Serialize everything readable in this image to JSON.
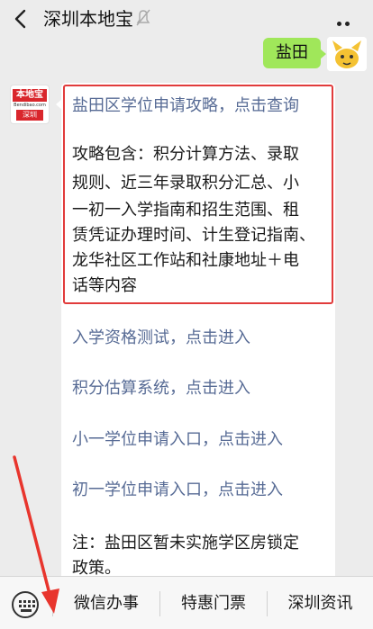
{
  "header": {
    "title": "深圳本地宝",
    "back_icon": "chevron-left-icon",
    "mute_icon": "mute-icon",
    "more_icon": "more-dots-icon"
  },
  "chat": {
    "sent_message": "盐田",
    "bot_logo": {
      "top": "本地宝",
      "mid": "Bendibao.com",
      "bottom": "深圳"
    },
    "lines": {
      "title_link": "盐田区学位申请攻略，点击查询",
      "para1_l1": "攻略包含：积分计算方法、录取",
      "para1_l2": "规则、近三年录取积分汇总、小",
      "para1_l3": "一初一入学指南和招生范围、租",
      "para1_l4": "赁凭证办理时间、计生登记指南、",
      "para1_l5": "龙华社区工作站和社康地址＋电",
      "para1_l6": "话等内容",
      "link1": "入学资格测试，点击进入",
      "link2": "积分估算系统，点击进入",
      "link3": "小一学位申请入口，点击进入",
      "link4": "初一学位申请入口，点击进入",
      "note_l1": "注：盐田区暂未实施学区房锁定",
      "note_l2": "政策。"
    }
  },
  "bottom_menu": {
    "keyboard_icon": "keyboard-icon",
    "items": [
      "微信办事",
      "特惠门票",
      "深圳资讯"
    ]
  },
  "colors": {
    "bubble_sent": "#a0e75a",
    "link": "#576b95",
    "highlight": "#e13b3b",
    "annotation_arrow": "#e8352d"
  }
}
